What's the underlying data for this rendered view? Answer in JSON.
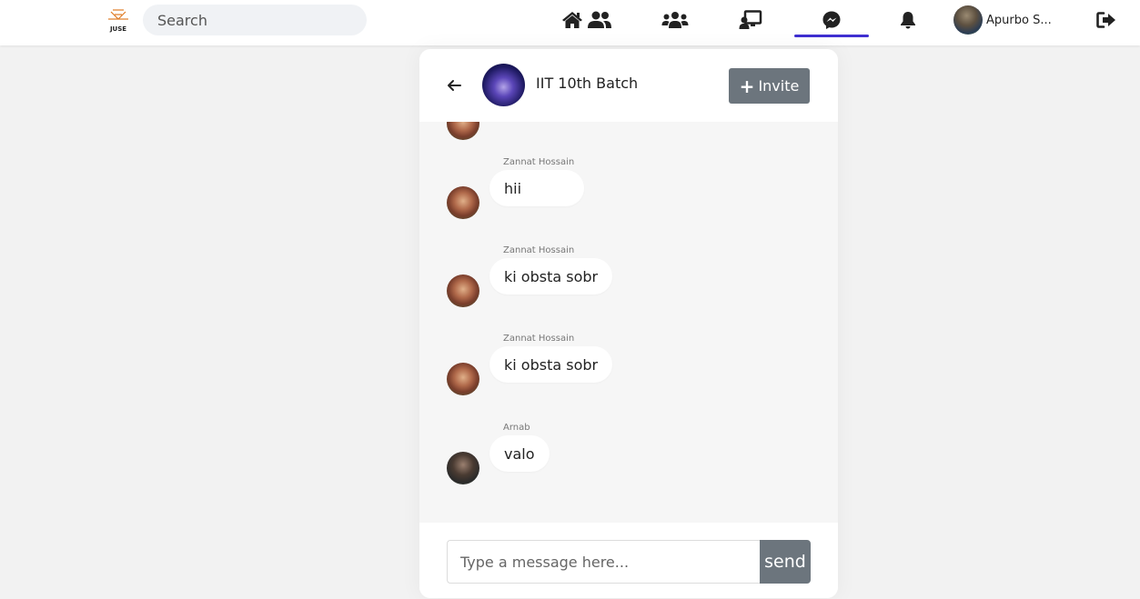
{
  "navbar": {
    "logo_text": "JUSE",
    "search_placeholder": "Search",
    "icons": [
      "home-icon",
      "friends-icon",
      "groups-icon",
      "screen-share-icon",
      "messenger-icon",
      "bell-icon"
    ],
    "active_icon": "messenger-icon",
    "user_name": "Apurbo S...",
    "logout_icon": "logout-icon",
    "accent_color": "#3f2fd1"
  },
  "chat": {
    "group_name": "IIT 10th Batch",
    "invite_label": "Invite",
    "messages": [
      {
        "sender": "Zannat Hossain",
        "text": "hii"
      },
      {
        "sender": "Zannat Hossain",
        "text": "ki obsta sobr"
      },
      {
        "sender": "Zannat Hossain",
        "text": "ki obsta sobr"
      },
      {
        "sender": "Arnab",
        "text": "valo"
      }
    ],
    "input_placeholder": "Type a message here...",
    "send_label": "send",
    "button_color": "#6c757d"
  }
}
